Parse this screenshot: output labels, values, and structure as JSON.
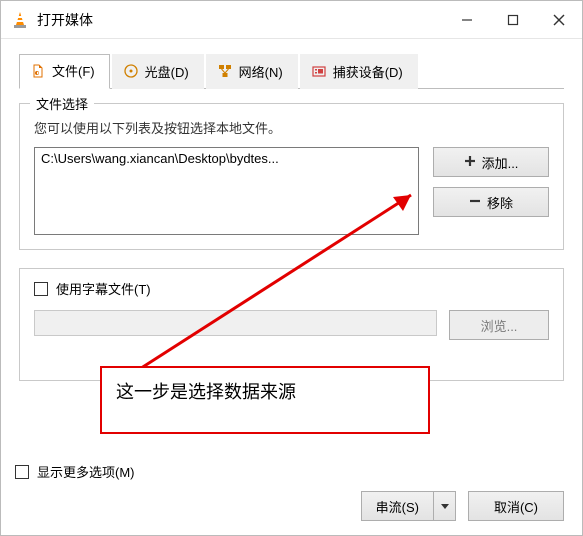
{
  "window": {
    "title": "打开媒体"
  },
  "tabs": {
    "file": {
      "label": "文件(F)"
    },
    "disc": {
      "label": "光盘(D)"
    },
    "network": {
      "label": "网络(N)"
    },
    "capture": {
      "label": "捕获设备(D)"
    }
  },
  "fileSection": {
    "legend": "文件选择",
    "desc": "您可以使用以下列表及按钮选择本地文件。",
    "items": [
      "C:\\Users\\wang.xiancan\\Desktop\\bydtes..."
    ],
    "add": "添加...",
    "remove": "移除"
  },
  "subtitle": {
    "checkbox": "使用字幕文件(T)",
    "browse": "浏览..."
  },
  "annotation": "这一步是选择数据来源",
  "more": "显示更多选项(M)",
  "footer": {
    "stream": "串流(S)",
    "cancel": "取消(C)"
  }
}
